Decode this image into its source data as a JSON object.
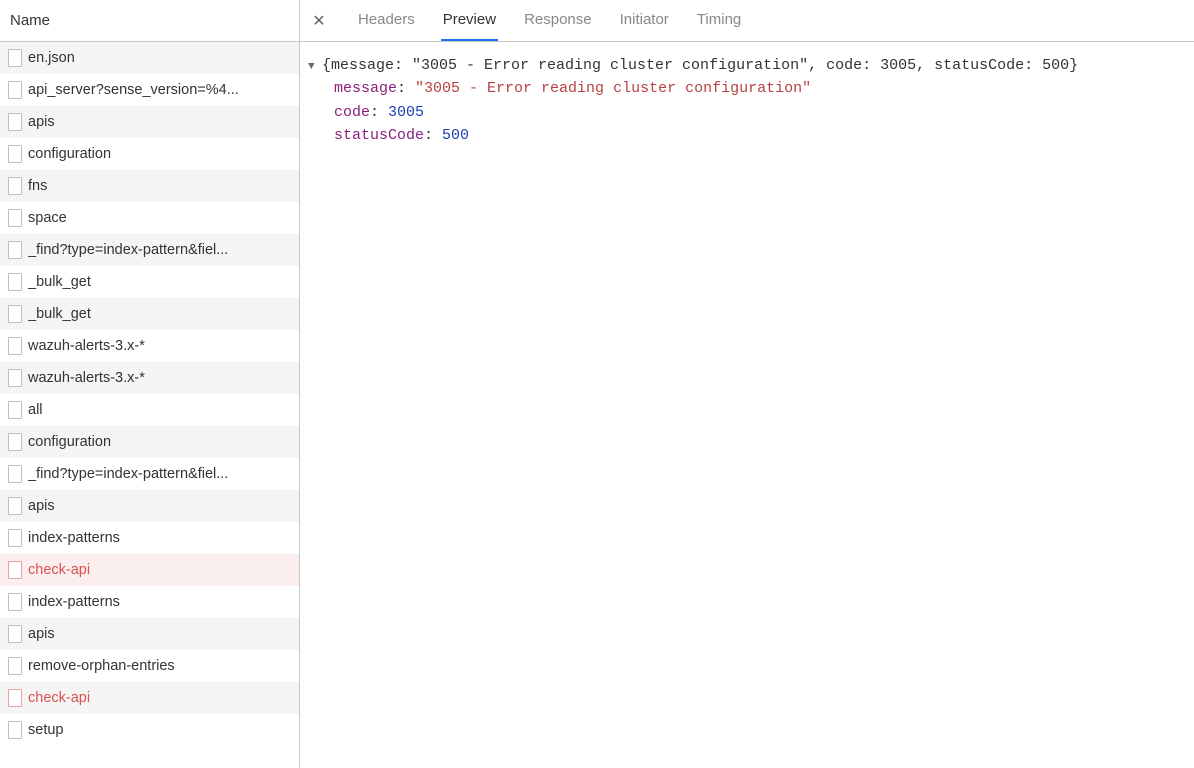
{
  "sidebar": {
    "header": "Name",
    "items": [
      {
        "name": "en.json",
        "error": false
      },
      {
        "name": "api_server?sense_version=%4...",
        "error": false
      },
      {
        "name": "apis",
        "error": false
      },
      {
        "name": "configuration",
        "error": false
      },
      {
        "name": "fns",
        "error": false
      },
      {
        "name": "space",
        "error": false
      },
      {
        "name": "_find?type=index-pattern&fiel...",
        "error": false
      },
      {
        "name": "_bulk_get",
        "error": false
      },
      {
        "name": "_bulk_get",
        "error": false
      },
      {
        "name": "wazuh-alerts-3.x-*",
        "error": false
      },
      {
        "name": "wazuh-alerts-3.x-*",
        "error": false
      },
      {
        "name": "all",
        "error": false
      },
      {
        "name": "configuration",
        "error": false
      },
      {
        "name": "_find?type=index-pattern&fiel...",
        "error": false
      },
      {
        "name": "apis",
        "error": false
      },
      {
        "name": "index-patterns",
        "error": false
      },
      {
        "name": "check-api",
        "error": true,
        "selected": true
      },
      {
        "name": "index-patterns",
        "error": false
      },
      {
        "name": "apis",
        "error": false
      },
      {
        "name": "remove-orphan-entries",
        "error": false
      },
      {
        "name": "check-api",
        "error": true
      },
      {
        "name": "setup",
        "error": false
      }
    ]
  },
  "tabs": {
    "headers": "Headers",
    "preview": "Preview",
    "response": "Response",
    "initiator": "Initiator",
    "timing": "Timing"
  },
  "preview": {
    "summary": "{message: \"3005 - Error reading cluster configuration\", code: 3005, statusCode: 500}",
    "message_key": "message",
    "message_val": "\"3005 - Error reading cluster configuration\"",
    "code_key": "code",
    "code_val": "3005",
    "status_key": "statusCode",
    "status_val": "500"
  }
}
